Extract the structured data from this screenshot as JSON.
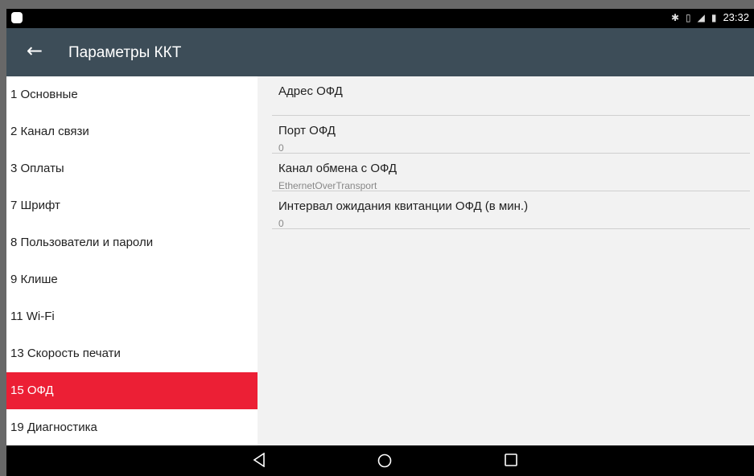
{
  "status_bar": {
    "time": "23:32",
    "icons": [
      "bluetooth-icon",
      "vibrate-icon",
      "no-signal-icon",
      "battery-charging-icon"
    ]
  },
  "app_bar": {
    "title": "Параметры ККТ",
    "back_icon": "arrow-left-icon"
  },
  "menu": {
    "items": [
      {
        "label": "1 Основные",
        "active": false
      },
      {
        "label": "2 Канал связи",
        "active": false
      },
      {
        "label": "3 Оплаты",
        "active": false
      },
      {
        "label": "7 Шрифт",
        "active": false
      },
      {
        "label": "8 Пользователи и пароли",
        "active": false
      },
      {
        "label": "9 Клише",
        "active": false
      },
      {
        "label": "11 Wi-Fi",
        "active": false
      },
      {
        "label": "13 Скорость печати",
        "active": false
      },
      {
        "label": "15 ОФД",
        "active": true
      },
      {
        "label": "19 Диагностика",
        "active": false
      }
    ],
    "active_color": "#ec1f35"
  },
  "preferences": [
    {
      "title": "Адрес ОФД",
      "summary": ""
    },
    {
      "title": "Порт ОФД",
      "summary": "0"
    },
    {
      "title": "Канал обмена с ОФД",
      "summary": "EthernetOverTransport"
    },
    {
      "title": "Интервал ожидания квитанции ОФД (в мин.)",
      "summary": "0"
    }
  ],
  "nav_bar": {
    "icons": [
      "nav-back-icon",
      "nav-home-icon",
      "nav-recents-icon"
    ]
  },
  "colors": {
    "app_bar": "#3d4d58",
    "accent": "#ec1f35"
  }
}
